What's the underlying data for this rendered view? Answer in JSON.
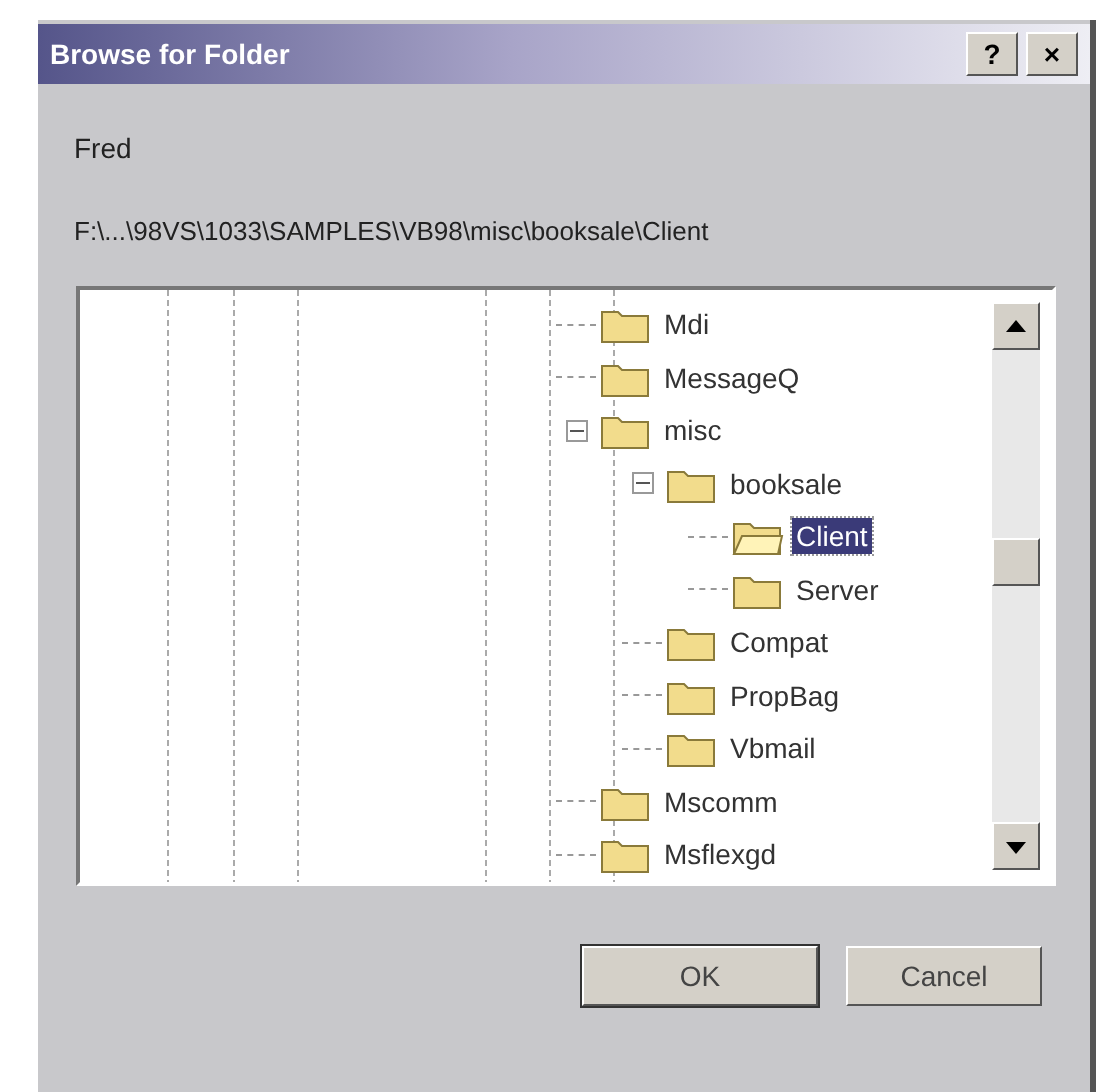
{
  "window": {
    "title": "Browse for Folder",
    "buttons": [
      "?",
      "×"
    ]
  },
  "prompt": "Fred",
  "path": "F:\\...\\98VS\\1033\\SAMPLES\\VB98\\misc\\booksale\\Client",
  "tree": [
    {
      "label": "Mdi",
      "selected": false,
      "expanded": false
    },
    {
      "label": "MessageQ",
      "selected": false,
      "expanded": false
    },
    {
      "label": "misc",
      "selected": false,
      "expanded": true,
      "children": [
        {
          "label": "booksale",
          "selected": false,
          "expanded": true,
          "children": [
            {
              "label": "Client",
              "selected": true,
              "expanded": false
            },
            {
              "label": "Server",
              "selected": false,
              "expanded": false
            }
          ]
        },
        {
          "label": "Compat",
          "selected": false,
          "expanded": false
        },
        {
          "label": "PropBag",
          "selected": false,
          "expanded": false
        },
        {
          "label": "Vbmail",
          "selected": false,
          "expanded": false
        }
      ]
    },
    {
      "label": "Mscomm",
      "selected": false,
      "expanded": false
    },
    {
      "label": "Msflexgd",
      "selected": false,
      "expanded": false
    }
  ],
  "buttons": [
    "OK",
    "Cancel"
  ]
}
